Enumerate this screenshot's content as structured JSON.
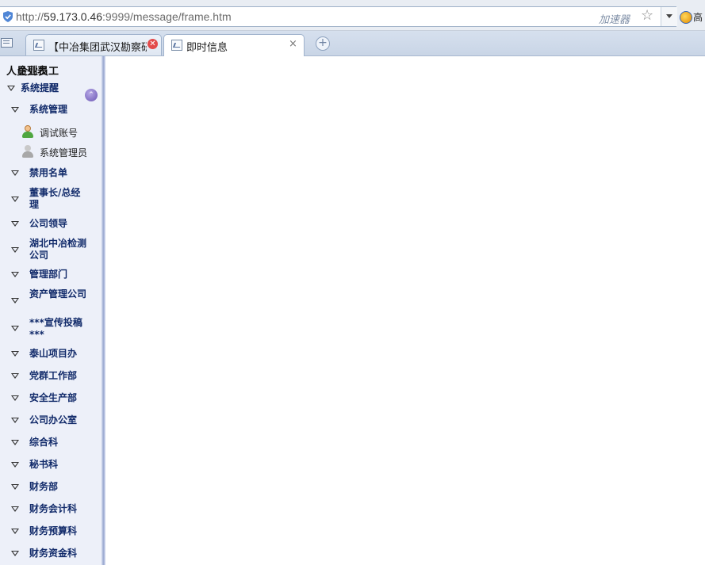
{
  "browser": {
    "url_prefix": "http://",
    "url_host": "59.173.0.46",
    "url_rest": ":9999/message/frame.htm",
    "accelerator_label": "加速器",
    "search_label": "高"
  },
  "tabs": [
    {
      "label": "【中冶集团武汉勘察研",
      "close": "✕"
    },
    {
      "label": "即时信息",
      "close": "×"
    }
  ],
  "sidebar": {
    "title_overlap_a": "人员列表",
    "title_overlap_b": "企业员工",
    "root": "系统提醒",
    "groups": [
      {
        "label": "系统管理"
      },
      {
        "label": "禁用名单"
      },
      {
        "label": "董事长/总经理"
      },
      {
        "label": "公司领导"
      },
      {
        "label": "湖北中冶检测公司"
      },
      {
        "label": "管理部门"
      },
      {
        "label": "资产管理公司"
      },
      {
        "label": "***宣传投稿***"
      },
      {
        "label": "泰山项目办"
      },
      {
        "label": "党群工作部"
      },
      {
        "label": "安全生产部"
      },
      {
        "label": "公司办公室"
      },
      {
        "label": "综合科"
      },
      {
        "label": "秘书科"
      },
      {
        "label": "财务部"
      },
      {
        "label": "财务会计科"
      },
      {
        "label": "财务预算科"
      },
      {
        "label": "财务资金科"
      }
    ],
    "users": [
      {
        "name": "调试账号",
        "status": "online"
      },
      {
        "name": "系统管理员",
        "status": "offline"
      }
    ]
  }
}
